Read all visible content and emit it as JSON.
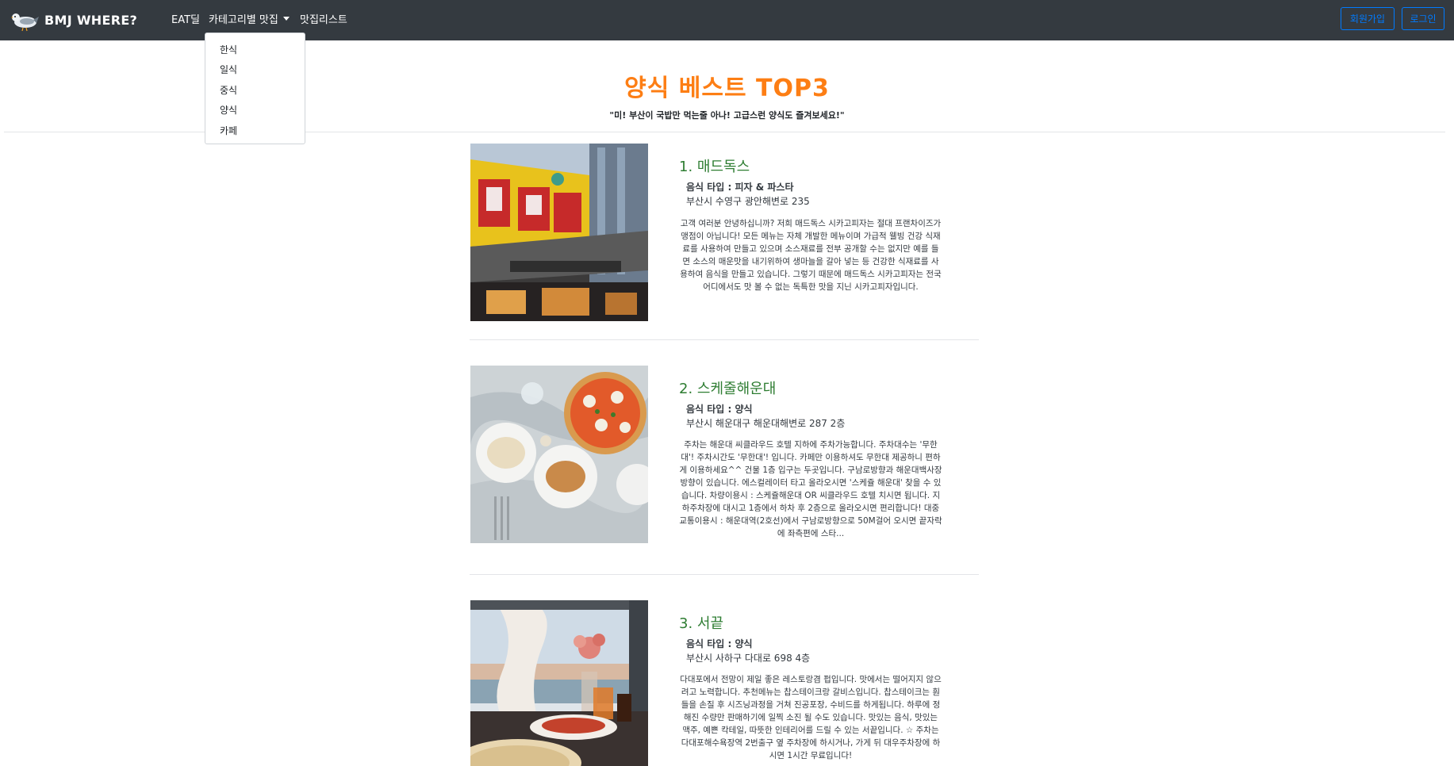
{
  "navbar": {
    "brand": "BMJ WHERE?",
    "links": {
      "eat": "EAT딜",
      "category": "카테고리별 맛집",
      "list": "맛집리스트"
    },
    "buttons": {
      "signup": "회원가입",
      "login": "로그인"
    }
  },
  "dropdown": {
    "items": [
      "한식",
      "일식",
      "중식",
      "양식",
      "카페"
    ]
  },
  "header": {
    "title": "양식 베스트 TOP3",
    "subtitle": "\"미! 부산이 국밥만 먹는줄 아나! 고급스런 양식도 즐겨보세요!\""
  },
  "restaurants": [
    {
      "title": "1. 매드독스",
      "type": "음식 타입 : 피자 & 파스타",
      "address": "부산시 수영구 광안해변로 235",
      "description": "고객 여러분 안녕하십니까? 저희 매드독스 시카고피자는 절대 프랜차이즈가맹점이 아닙니다! 모든 메뉴는 자체 개발한 메뉴이며 가급적 웰빙 건강 식재료를 사용하여 만들고 있으며 소스재료를 전부 공개할 수는 없지만 예를 들면 소스의 매운맛을 내기위하여 생마늘을 갈아 넣는 등 건강한 식재료를 사용하여 음식을 만들고 있습니다. 그렇기 때문에 매드독스 시카고피자는 전국 어디에서도 맛 볼 수 없는 독특한 맛을 지닌 시카고피자입니다."
    },
    {
      "title": "2. 스케줄해운대",
      "type": "음식 타입 : 양식",
      "address": "부산시 해운대구 해운대해변로 287 2층",
      "description": "주차는 해운대 씨클라우드 호텔 지하에 주차가능합니다. 주차대수는 '무한대'! 주차시간도 '무한대'! 입니다. 카페만 이용하셔도 무한대 제공하니 편하게 이용하세요^^ 건물 1층 입구는 두곳입니다. 구남로방향과 해운대백사장 방향이 있습니다. 에스컬레이터 타고 올라오시면 '스케쥴 해운대' 찾을 수 있습니다. 차량이용시 : 스케쥴해운대 OR 씨클라우드 호텔 치시면 됩니다. 지하주차장에 대시고 1층에서 하차 후 2층으로 올라오시면 편리합니다! 대중교통이용시 : 해운대역(2호선)에서 구남로방향으로 50M걸어 오시면 끝자락에 좌측편에 스타..."
    },
    {
      "title": "3. 서끝",
      "type": "음식 타입 : 양식",
      "address": "부산시 사하구 다대로 698 4층",
      "description": "다대포에서 전망이 제일 좋은 레스토랑겸 펍입니다. 맛에서는 떨어지지 않으려고 노력합니다. 추천메뉴는 찹스테이크랑 갈비스입니다. 찹스테이크는 훤들을 손질 후 시즈닝과정을 거쳐 진공포장, 수비드를 하게됩니다. 하루에 정해진 수량만 판매하기에 일찍 소진 될 수도 있습니다. 맛있는 음식, 맛있는 맥주, 예쁜 칵테일, 따뜻한 인테리어를 드릴 수 있는 서끝입니다. ☆ 주차는 다대포해수욕장역 2번출구 옆 주차장에 하시거나, 가게 뒤 대우주차장에 하시면 1시간 무료입니다!"
    }
  ]
}
